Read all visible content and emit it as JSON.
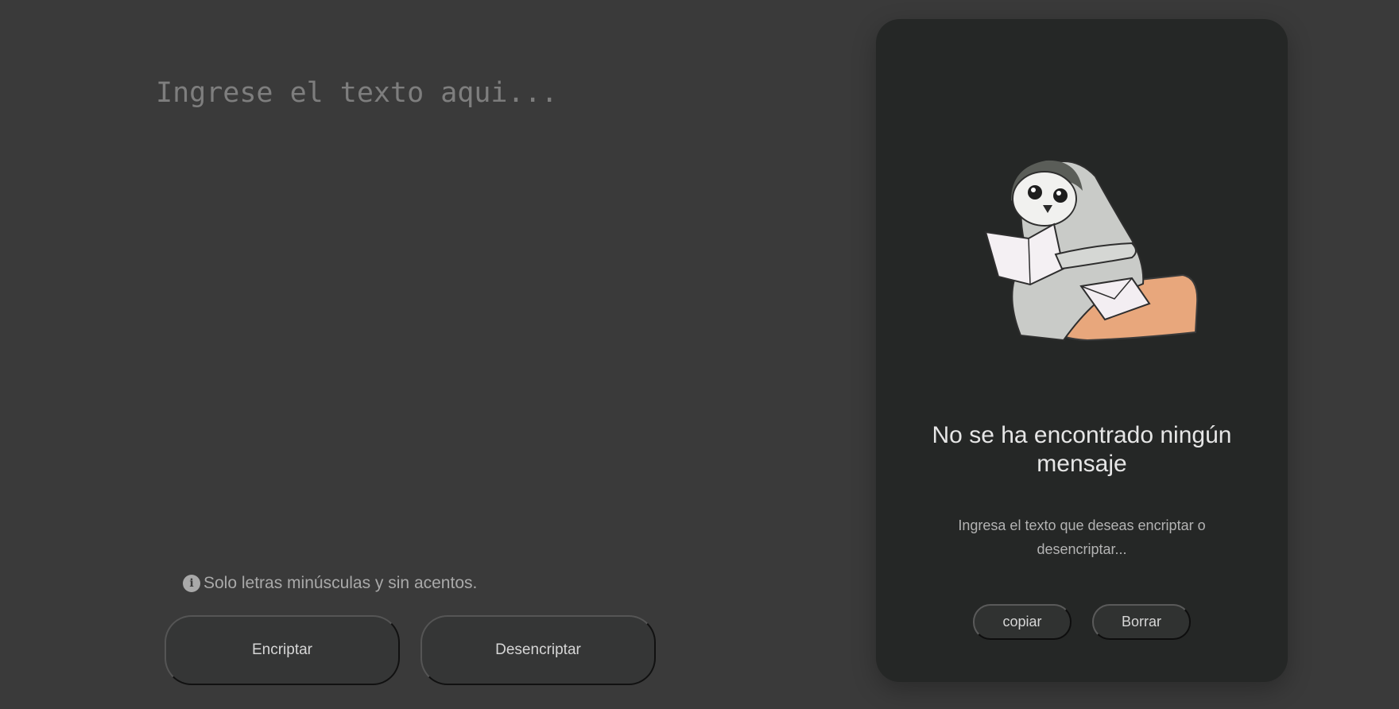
{
  "input": {
    "placeholder": "Ingrese el texto aqui...",
    "value": ""
  },
  "hint": {
    "icon": "info-icon",
    "text": "Solo letras minúsculas y sin acentos."
  },
  "actions": {
    "encrypt_label": "Encriptar",
    "decrypt_label": "Desencriptar"
  },
  "result": {
    "illustration": "penguin-reading-letter",
    "title": "No se ha encontrado ningún mensaje",
    "description": "Ingresa el texto que deseas encriptar o desencriptar...",
    "copy_label": "copiar",
    "clear_label": "Borrar"
  },
  "colors": {
    "background": "#3a3a3a",
    "card": "#252726",
    "button": "#353636",
    "text": "#d6d6d6"
  }
}
